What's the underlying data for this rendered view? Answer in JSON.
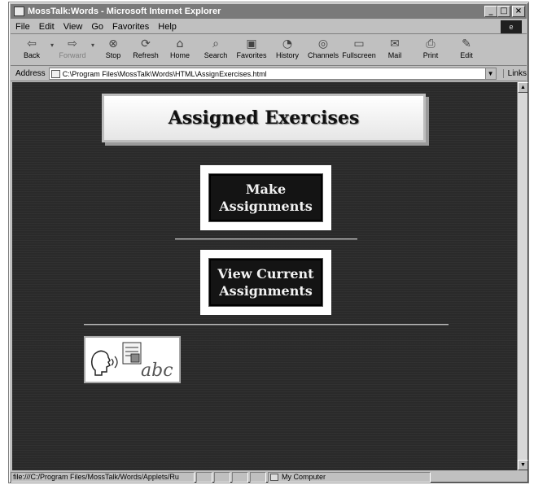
{
  "window": {
    "title": "MossTalk:Words - Microsoft Internet Explorer"
  },
  "menu": [
    "File",
    "Edit",
    "View",
    "Go",
    "Favorites",
    "Help"
  ],
  "toolbar": [
    {
      "label": "Back",
      "icon": "back-arrow-icon",
      "glyph": "⇦"
    },
    {
      "label": "Forward",
      "icon": "forward-arrow-icon",
      "glyph": "⇨",
      "disabled": true
    },
    {
      "label": "Stop",
      "icon": "stop-icon",
      "glyph": "⊗"
    },
    {
      "label": "Refresh",
      "icon": "refresh-icon",
      "glyph": "⟳"
    },
    {
      "label": "Home",
      "icon": "home-icon",
      "glyph": "⌂"
    },
    {
      "label": "Search",
      "icon": "search-icon",
      "glyph": "⌕"
    },
    {
      "label": "Favorites",
      "icon": "favorites-icon",
      "glyph": "▣"
    },
    {
      "label": "History",
      "icon": "history-icon",
      "glyph": "◔"
    },
    {
      "label": "Channels",
      "icon": "channels-icon",
      "glyph": "◎"
    },
    {
      "label": "Fullscreen",
      "icon": "fullscreen-icon",
      "glyph": "▭"
    },
    {
      "label": "Mail",
      "icon": "mail-icon",
      "glyph": "✉"
    },
    {
      "label": "Print",
      "icon": "print-icon",
      "glyph": "⎙"
    },
    {
      "label": "Edit",
      "icon": "edit-icon",
      "glyph": "✎"
    }
  ],
  "address": {
    "label": "Address",
    "value": "C:\\Program Files\\MossTalk\\Words\\HTML\\AssignExercises.html",
    "links_label": "Links"
  },
  "page": {
    "title": "Assigned Exercises",
    "make_assignments": "Make Assignments",
    "view_current": "View Current Assignments",
    "logo_text": "abc"
  },
  "status": {
    "url": "file:///C:/Program Files/MossTalk/Words/Applets/Ru",
    "zone": "My Computer"
  }
}
